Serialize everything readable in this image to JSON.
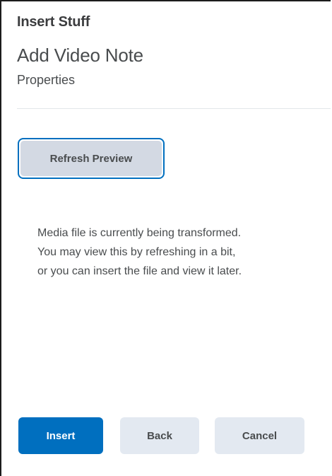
{
  "dialog": {
    "title": "Insert Stuff"
  },
  "page": {
    "title": "Add Video Note",
    "subtitle": "Properties"
  },
  "preview": {
    "refresh_label": "Refresh Preview",
    "message_lines": [
      "Media file is currently being transformed.",
      "You may view this by refreshing in a bit,",
      "or you can insert the file and view it later."
    ]
  },
  "footer": {
    "insert_label": "Insert",
    "back_label": "Back",
    "cancel_label": "Cancel"
  },
  "colors": {
    "primary": "#006fbf",
    "secondary_button_bg": "#e3e9f1",
    "refresh_button_bg": "#d3d9e3",
    "text": "#494c4e"
  }
}
